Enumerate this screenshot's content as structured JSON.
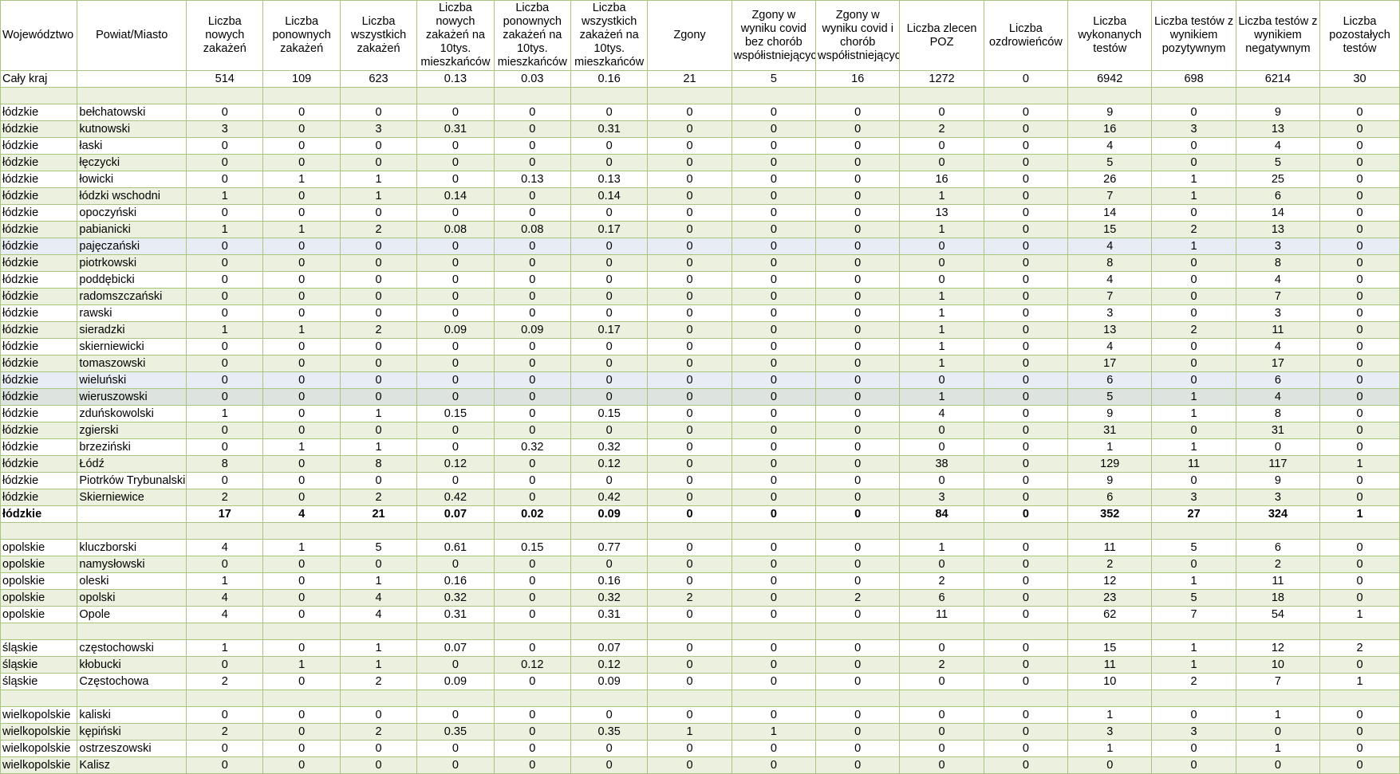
{
  "headers": [
    "Województwo",
    "Powiat/Miasto",
    "Liczba nowych zakażeń",
    "Liczba ponownych zakażeń",
    "Liczba wszystkich zakażeń",
    "Liczba nowych zakażeń na 10tys. mieszkańców",
    "Liczba ponownych zakażeń na 10tys. mieszkańców",
    "Liczba wszystkich zakażeń na 10tys. mieszkańców",
    "Zgony",
    "Zgony w wyniku covid bez chorób współistniejących",
    "Zgony w wyniku covid i chorób współistniejących",
    "Liczba zlecen POZ",
    "Liczba ozdrowieńców",
    "Liczba wykonanych testów",
    "Liczba testów z wynikiem pozytywnym",
    "Liczba testów z wynikiem negatywnym",
    "Liczba pozostałych testów"
  ],
  "rows": [
    {
      "cells": [
        "Cały kraj",
        "",
        "514",
        "109",
        "623",
        "0.13",
        "0.03",
        "0.16",
        "21",
        "5",
        "16",
        "1272",
        "0",
        "6942",
        "698",
        "6214",
        "30"
      ],
      "style": "odd"
    },
    {
      "cells": [
        "",
        "",
        "",
        "",
        "",
        "",
        "",
        "",
        "",
        "",
        "",
        "",
        "",
        "",
        "",
        "",
        ""
      ],
      "style": "sep"
    },
    {
      "cells": [
        "łódzkie",
        "bełchatowski",
        "0",
        "0",
        "0",
        "0",
        "0",
        "0",
        "0",
        "0",
        "0",
        "0",
        "0",
        "9",
        "0",
        "9",
        "0"
      ],
      "style": "odd"
    },
    {
      "cells": [
        "łódzkie",
        "kutnowski",
        "3",
        "0",
        "3",
        "0.31",
        "0",
        "0.31",
        "0",
        "0",
        "0",
        "2",
        "0",
        "16",
        "3",
        "13",
        "0"
      ],
      "style": "even"
    },
    {
      "cells": [
        "łódzkie",
        "łaski",
        "0",
        "0",
        "0",
        "0",
        "0",
        "0",
        "0",
        "0",
        "0",
        "0",
        "0",
        "4",
        "0",
        "4",
        "0"
      ],
      "style": "odd"
    },
    {
      "cells": [
        "łódzkie",
        "łęczycki",
        "0",
        "0",
        "0",
        "0",
        "0",
        "0",
        "0",
        "0",
        "0",
        "0",
        "0",
        "5",
        "0",
        "5",
        "0"
      ],
      "style": "even"
    },
    {
      "cells": [
        "łódzkie",
        "łowicki",
        "0",
        "1",
        "1",
        "0",
        "0.13",
        "0.13",
        "0",
        "0",
        "0",
        "16",
        "0",
        "26",
        "1",
        "25",
        "0"
      ],
      "style": "odd"
    },
    {
      "cells": [
        "łódzkie",
        "łódzki wschodni",
        "1",
        "0",
        "1",
        "0.14",
        "0",
        "0.14",
        "0",
        "0",
        "0",
        "1",
        "0",
        "7",
        "1",
        "6",
        "0"
      ],
      "style": "even"
    },
    {
      "cells": [
        "łódzkie",
        "opoczyński",
        "0",
        "0",
        "0",
        "0",
        "0",
        "0",
        "0",
        "0",
        "0",
        "13",
        "0",
        "14",
        "0",
        "14",
        "0"
      ],
      "style": "odd"
    },
    {
      "cells": [
        "łódzkie",
        "pabianicki",
        "1",
        "1",
        "2",
        "0.08",
        "0.08",
        "0.17",
        "0",
        "0",
        "0",
        "1",
        "0",
        "15",
        "2",
        "13",
        "0"
      ],
      "style": "even"
    },
    {
      "cells": [
        "łódzkie",
        "pajęczański",
        "0",
        "0",
        "0",
        "0",
        "0",
        "0",
        "0",
        "0",
        "0",
        "0",
        "0",
        "4",
        "1",
        "3",
        "0"
      ],
      "style": "hl-blue"
    },
    {
      "cells": [
        "łódzkie",
        "piotrkowski",
        "0",
        "0",
        "0",
        "0",
        "0",
        "0",
        "0",
        "0",
        "0",
        "0",
        "0",
        "8",
        "0",
        "8",
        "0"
      ],
      "style": "even"
    },
    {
      "cells": [
        "łódzkie",
        "poddębicki",
        "0",
        "0",
        "0",
        "0",
        "0",
        "0",
        "0",
        "0",
        "0",
        "0",
        "0",
        "4",
        "0",
        "4",
        "0"
      ],
      "style": "odd"
    },
    {
      "cells": [
        "łódzkie",
        "radomszczański",
        "0",
        "0",
        "0",
        "0",
        "0",
        "0",
        "0",
        "0",
        "0",
        "1",
        "0",
        "7",
        "0",
        "7",
        "0"
      ],
      "style": "even"
    },
    {
      "cells": [
        "łódzkie",
        "rawski",
        "0",
        "0",
        "0",
        "0",
        "0",
        "0",
        "0",
        "0",
        "0",
        "1",
        "0",
        "3",
        "0",
        "3",
        "0"
      ],
      "style": "odd"
    },
    {
      "cells": [
        "łódzkie",
        "sieradzki",
        "1",
        "1",
        "2",
        "0.09",
        "0.09",
        "0.17",
        "0",
        "0",
        "0",
        "1",
        "0",
        "13",
        "2",
        "11",
        "0"
      ],
      "style": "even"
    },
    {
      "cells": [
        "łódzkie",
        "skierniewicki",
        "0",
        "0",
        "0",
        "0",
        "0",
        "0",
        "0",
        "0",
        "0",
        "1",
        "0",
        "4",
        "0",
        "4",
        "0"
      ],
      "style": "odd"
    },
    {
      "cells": [
        "łódzkie",
        "tomaszowski",
        "0",
        "0",
        "0",
        "0",
        "0",
        "0",
        "0",
        "0",
        "0",
        "1",
        "0",
        "17",
        "0",
        "17",
        "0"
      ],
      "style": "even"
    },
    {
      "cells": [
        "łódzkie",
        "wieluński",
        "0",
        "0",
        "0",
        "0",
        "0",
        "0",
        "0",
        "0",
        "0",
        "0",
        "0",
        "6",
        "0",
        "6",
        "0"
      ],
      "style": "hl-blue"
    },
    {
      "cells": [
        "łódzkie",
        "wieruszowski",
        "0",
        "0",
        "0",
        "0",
        "0",
        "0",
        "0",
        "0",
        "0",
        "1",
        "0",
        "5",
        "1",
        "4",
        "0"
      ],
      "style": "hl-grey"
    },
    {
      "cells": [
        "łódzkie",
        "zduńskowolski",
        "1",
        "0",
        "1",
        "0.15",
        "0",
        "0.15",
        "0",
        "0",
        "0",
        "4",
        "0",
        "9",
        "1",
        "8",
        "0"
      ],
      "style": "odd"
    },
    {
      "cells": [
        "łódzkie",
        "zgierski",
        "0",
        "0",
        "0",
        "0",
        "0",
        "0",
        "0",
        "0",
        "0",
        "0",
        "0",
        "31",
        "0",
        "31",
        "0"
      ],
      "style": "even"
    },
    {
      "cells": [
        "łódzkie",
        "brzeziński",
        "0",
        "1",
        "1",
        "0",
        "0.32",
        "0.32",
        "0",
        "0",
        "0",
        "0",
        "0",
        "1",
        "1",
        "0",
        "0"
      ],
      "style": "odd"
    },
    {
      "cells": [
        "łódzkie",
        "Łódź",
        "8",
        "0",
        "8",
        "0.12",
        "0",
        "0.12",
        "0",
        "0",
        "0",
        "38",
        "0",
        "129",
        "11",
        "117",
        "1"
      ],
      "style": "even"
    },
    {
      "cells": [
        "łódzkie",
        "Piotrków Trybunalski",
        "0",
        "0",
        "0",
        "0",
        "0",
        "0",
        "0",
        "0",
        "0",
        "0",
        "0",
        "9",
        "0",
        "9",
        "0"
      ],
      "style": "odd"
    },
    {
      "cells": [
        "łódzkie",
        "Skierniewice",
        "2",
        "0",
        "2",
        "0.42",
        "0",
        "0.42",
        "0",
        "0",
        "0",
        "3",
        "0",
        "6",
        "3",
        "3",
        "0"
      ],
      "style": "even"
    },
    {
      "cells": [
        "łódzkie",
        "",
        "17",
        "4",
        "21",
        "0.07",
        "0.02",
        "0.09",
        "0",
        "0",
        "0",
        "84",
        "0",
        "352",
        "27",
        "324",
        "1"
      ],
      "style": "total"
    },
    {
      "cells": [
        "",
        "",
        "",
        "",
        "",
        "",
        "",
        "",
        "",
        "",
        "",
        "",
        "",
        "",
        "",
        "",
        ""
      ],
      "style": "sep"
    },
    {
      "cells": [
        "opolskie",
        "kluczborski",
        "4",
        "1",
        "5",
        "0.61",
        "0.15",
        "0.77",
        "0",
        "0",
        "0",
        "1",
        "0",
        "11",
        "5",
        "6",
        "0"
      ],
      "style": "odd"
    },
    {
      "cells": [
        "opolskie",
        "namysłowski",
        "0",
        "0",
        "0",
        "0",
        "0",
        "0",
        "0",
        "0",
        "0",
        "0",
        "0",
        "2",
        "0",
        "2",
        "0"
      ],
      "style": "even"
    },
    {
      "cells": [
        "opolskie",
        "oleski",
        "1",
        "0",
        "1",
        "0.16",
        "0",
        "0.16",
        "0",
        "0",
        "0",
        "2",
        "0",
        "12",
        "1",
        "11",
        "0"
      ],
      "style": "odd"
    },
    {
      "cells": [
        "opolskie",
        "opolski",
        "4",
        "0",
        "4",
        "0.32",
        "0",
        "0.32",
        "2",
        "0",
        "2",
        "6",
        "0",
        "23",
        "5",
        "18",
        "0"
      ],
      "style": "even"
    },
    {
      "cells": [
        "opolskie",
        "Opole",
        "4",
        "0",
        "4",
        "0.31",
        "0",
        "0.31",
        "0",
        "0",
        "0",
        "11",
        "0",
        "62",
        "7",
        "54",
        "1"
      ],
      "style": "odd"
    },
    {
      "cells": [
        "",
        "",
        "",
        "",
        "",
        "",
        "",
        "",
        "",
        "",
        "",
        "",
        "",
        "",
        "",
        "",
        ""
      ],
      "style": "sep"
    },
    {
      "cells": [
        "śląskie",
        "częstochowski",
        "1",
        "0",
        "1",
        "0.07",
        "0",
        "0.07",
        "0",
        "0",
        "0",
        "0",
        "0",
        "15",
        "1",
        "12",
        "2"
      ],
      "style": "odd"
    },
    {
      "cells": [
        "śląskie",
        "kłobucki",
        "0",
        "1",
        "1",
        "0",
        "0.12",
        "0.12",
        "0",
        "0",
        "0",
        "2",
        "0",
        "11",
        "1",
        "10",
        "0"
      ],
      "style": "even"
    },
    {
      "cells": [
        "śląskie",
        "Częstochowa",
        "2",
        "0",
        "2",
        "0.09",
        "0",
        "0.09",
        "0",
        "0",
        "0",
        "0",
        "0",
        "10",
        "2",
        "7",
        "1"
      ],
      "style": "odd"
    },
    {
      "cells": [
        "",
        "",
        "",
        "",
        "",
        "",
        "",
        "",
        "",
        "",
        "",
        "",
        "",
        "",
        "",
        "",
        ""
      ],
      "style": "sep"
    },
    {
      "cells": [
        "wielkopolskie",
        "kaliski",
        "0",
        "0",
        "0",
        "0",
        "0",
        "0",
        "0",
        "0",
        "0",
        "0",
        "0",
        "1",
        "0",
        "1",
        "0"
      ],
      "style": "odd"
    },
    {
      "cells": [
        "wielkopolskie",
        "kępiński",
        "2",
        "0",
        "2",
        "0.35",
        "0",
        "0.35",
        "1",
        "1",
        "0",
        "0",
        "0",
        "3",
        "3",
        "0",
        "0"
      ],
      "style": "even"
    },
    {
      "cells": [
        "wielkopolskie",
        "ostrzeszowski",
        "0",
        "0",
        "0",
        "0",
        "0",
        "0",
        "0",
        "0",
        "0",
        "0",
        "0",
        "1",
        "0",
        "1",
        "0"
      ],
      "style": "odd"
    },
    {
      "cells": [
        "wielkopolskie",
        "Kalisz",
        "0",
        "0",
        "0",
        "0",
        "0",
        "0",
        "0",
        "0",
        "0",
        "0",
        "0",
        "0",
        "0",
        "0",
        "0"
      ],
      "style": "even"
    }
  ]
}
